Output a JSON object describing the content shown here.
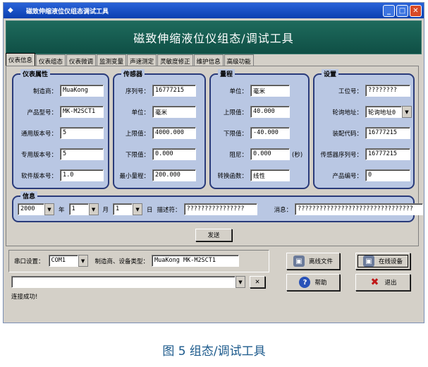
{
  "window": {
    "title": "磁致伸缩液位仪组态调试工具",
    "controls": [
      "_",
      "□",
      "✕"
    ]
  },
  "banner": {
    "title": "磁致伸缩液位仪组态/调试工具"
  },
  "tabs": [
    "仪表信息",
    "仪表组态",
    "仪表微调",
    "监测变量",
    "声速测定",
    "灵敏度修正",
    "维护信息",
    "高级功能"
  ],
  "groups": {
    "instrument": {
      "legend": "仪表属性",
      "rows": [
        {
          "label": "制造商：",
          "value": "MuaKong"
        },
        {
          "label": "产品型号：",
          "value": "MK-M2SCT1"
        },
        {
          "label": "通用版本号：",
          "value": "5"
        },
        {
          "label": "专用版本号：",
          "value": "5"
        },
        {
          "label": "软件版本号：",
          "value": "1.0"
        }
      ]
    },
    "sensor": {
      "legend": "传感器",
      "rows": [
        {
          "label": "序列号：",
          "value": "16777215"
        },
        {
          "label": "单位：",
          "value": "毫米"
        },
        {
          "label": "上限值：",
          "value": "4000.000"
        },
        {
          "label": "下限值：",
          "value": "0.000"
        },
        {
          "label": "最小量程：",
          "value": "200.000"
        }
      ]
    },
    "range": {
      "legend": "量程",
      "rows": [
        {
          "label": "单位：",
          "value": "毫米"
        },
        {
          "label": "上限值：",
          "value": "40.000"
        },
        {
          "label": "下限值：",
          "value": "-40.000"
        },
        {
          "label": "阻尼：",
          "value": "0.000",
          "unit": "(秒)"
        },
        {
          "label": "转换函数：",
          "value": "线性"
        }
      ]
    },
    "settings": {
      "legend": "设置",
      "rows": [
        {
          "label": "工位号：",
          "value": "????????"
        },
        {
          "label": "轮询地址：",
          "value": "轮询地址0"
        },
        {
          "label": "装配代码：",
          "value": "16777215"
        },
        {
          "label": "传感器序列号：",
          "value": "16777215"
        },
        {
          "label": "产品编号：",
          "value": "0"
        }
      ]
    },
    "info": {
      "legend": "信息",
      "year": "2000",
      "year_unit": "年",
      "month": "1",
      "month_unit": "月",
      "day": "1",
      "day_unit": "日",
      "desc_label": "描述符：",
      "desc_value": "????????????????",
      "msg_label": "消息：",
      "msg_value": "????????????????????????????????"
    }
  },
  "send_button": "发送",
  "bottom": {
    "port_label": "串口设置：",
    "port_value": "COM1",
    "device_label": "制造商、设备类型：",
    "device_value": "MuaKong MK-M2SCT1",
    "offline_button": "离线文件",
    "online_button": "在线设备",
    "help_button": "帮助",
    "exit_button": "退出",
    "clear_button": "✕",
    "status": "连接成功!"
  },
  "caption": "图 5  组态/调试工具"
}
